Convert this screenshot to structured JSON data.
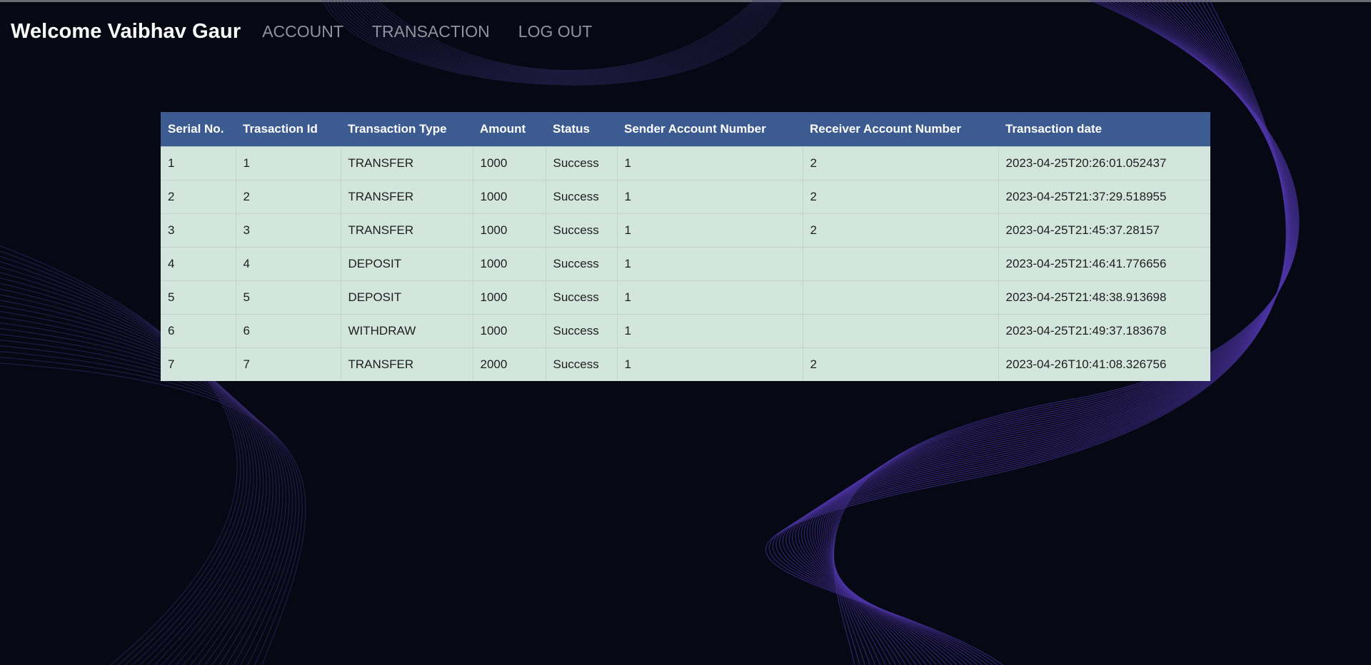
{
  "nav": {
    "brand": "Welcome Vaibhav Gaur",
    "links": [
      "ACCOUNT",
      "TRANSACTION",
      "LOG OUT"
    ]
  },
  "table": {
    "headers": [
      "Serial No.",
      "Trasaction Id",
      "Transaction Type",
      "Amount",
      "Status",
      "Sender Account Number",
      "Receiver Account Number",
      "Transaction date"
    ],
    "rows": [
      [
        "1",
        "1",
        "TRANSFER",
        "1000",
        "Success",
        "1",
        "2",
        "2023-04-25T20:26:01.052437"
      ],
      [
        "2",
        "2",
        "TRANSFER",
        "1000",
        "Success",
        "1",
        "2",
        "2023-04-25T21:37:29.518955"
      ],
      [
        "3",
        "3",
        "TRANSFER",
        "1000",
        "Success",
        "1",
        "2",
        "2023-04-25T21:45:37.28157"
      ],
      [
        "4",
        "4",
        "DEPOSIT",
        "1000",
        "Success",
        "1",
        "",
        "2023-04-25T21:46:41.776656"
      ],
      [
        "5",
        "5",
        "DEPOSIT",
        "1000",
        "Success",
        "1",
        "",
        "2023-04-25T21:48:38.913698"
      ],
      [
        "6",
        "6",
        "WITHDRAW",
        "1000",
        "Success",
        "1",
        "",
        "2023-04-25T21:49:37.183678"
      ],
      [
        "7",
        "7",
        "TRANSFER",
        "2000",
        "Success",
        "1",
        "2",
        "2023-04-26T10:41:08.326756"
      ]
    ]
  },
  "colors": {
    "background": "#060814",
    "header_bg": "#3b5b91",
    "row_bg": "#d2e6dd",
    "wave": "#5a3fb0"
  }
}
